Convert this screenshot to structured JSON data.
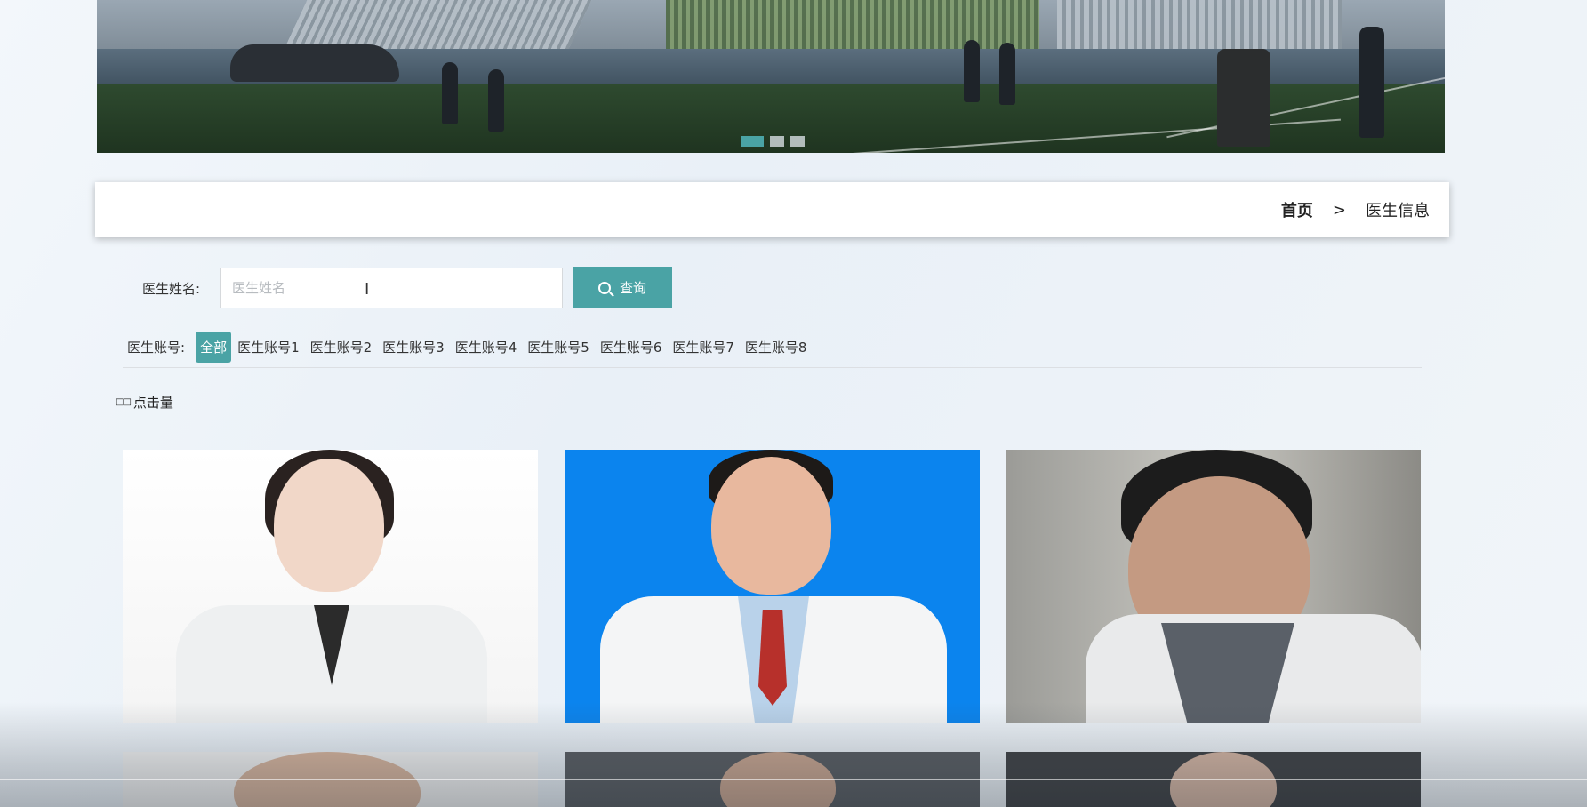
{
  "banner": {
    "slide_count": 3,
    "active_slide": 1
  },
  "breadcrumb": {
    "home": "首页",
    "separator": ">",
    "current": "医生信息"
  },
  "search": {
    "label": "医生姓名:",
    "placeholder": "医生姓名",
    "value": "",
    "button_label": "查询"
  },
  "filter": {
    "label": "医生账号:",
    "items": [
      "全部",
      "医生账号1",
      "医生账号2",
      "医生账号3",
      "医生账号4",
      "医生账号5",
      "医生账号6",
      "医生账号7",
      "医生账号8"
    ],
    "active_index": 0
  },
  "sort": {
    "icon": "sort-icon",
    "label": "点击量"
  },
  "colors": {
    "accent": "#4aa3a5",
    "card_blue": "#0b84ee"
  }
}
